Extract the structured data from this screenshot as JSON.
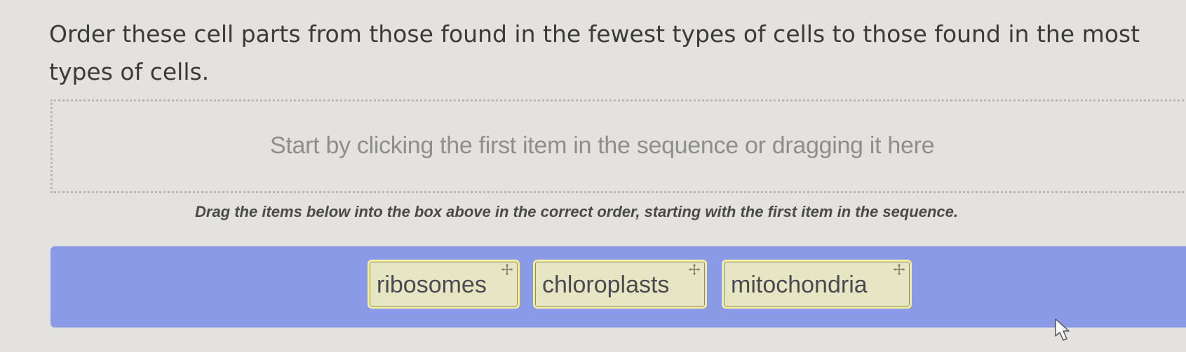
{
  "question": {
    "text": "Order these cell parts from those found in the fewest types of cells to those found in the most types of cells."
  },
  "drop_zone": {
    "hint": "Start by clicking the first item in the sequence or dragging it here"
  },
  "instruction": "Drag the items below into the box above in the correct order, starting with the first item in the sequence.",
  "items": [
    {
      "label": "ribosomes",
      "icon": "move-icon"
    },
    {
      "label": "chloroplasts",
      "icon": "move-icon"
    },
    {
      "label": "mitochondria",
      "icon": "move-icon"
    }
  ],
  "colors": {
    "background": "#e3e2de",
    "item_bank": "#8b9ae6",
    "item_fill": "#e6e6c4",
    "item_border": "#f2ee9a"
  }
}
